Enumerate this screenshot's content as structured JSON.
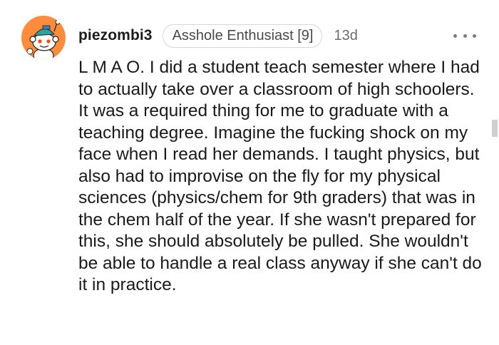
{
  "comment": {
    "username": "piezombi3",
    "flair": "Asshole Enthusiast [9]",
    "age": "13d",
    "more_icon": "ellipsis-icon",
    "avatar_icon": "snoo-avatar-icon",
    "text": "L M A O. I did a student teach semester where I had to actually take over a classroom of high schoolers. It was a required thing for me to graduate with a teaching degree. Imagine the fucking shock on my face when I read her demands. I taught physics, but also had to improvise on the fly for my physical sciences (physics/chem for 9th graders) that was in the chem half of the year. If she wasn't prepared for this, she should absolutely be pulled. She wouldn't be able to handle a real class anyway if she can't do it in practice."
  },
  "colors": {
    "avatar_bg": "#ff8b3d",
    "text": "#1a1a1b",
    "muted": "#6d6d6d",
    "flair_border": "#d7d7d7"
  }
}
